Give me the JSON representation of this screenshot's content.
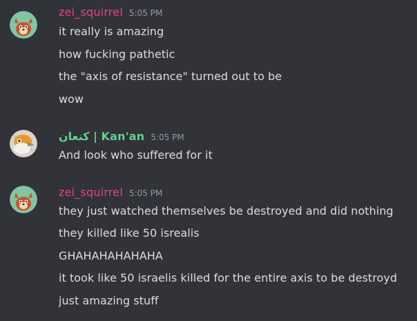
{
  "messages": [
    {
      "username": "zei_squirrel",
      "timestamp": "5:05 PM",
      "avatar_icon": "red-squirrel-avatar",
      "name_color": "#ea3e8a",
      "lines": [
        "it really is amazing",
        "how fucking pathetic",
        "the \"axis of resistance\" turned out to be",
        "wow"
      ]
    },
    {
      "username": "كنعان | Kan'an",
      "timestamp": "5:05 PM",
      "avatar_icon": "orange-bird-avatar",
      "name_color": "#5fd388",
      "lines": [
        "And look who suffered for it"
      ]
    },
    {
      "username": "zei_squirrel",
      "timestamp": "5:05 PM",
      "avatar_icon": "red-squirrel-avatar",
      "name_color": "#ea3e8a",
      "lines": [
        "they just watched themselves be destroyed and did nothing",
        "they killed like 50 isrealis",
        "GHAHAHAHAHAHA",
        "it took like 50 israelis killed for the entire axis to be destroyd",
        "just amazing stuff"
      ]
    }
  ]
}
